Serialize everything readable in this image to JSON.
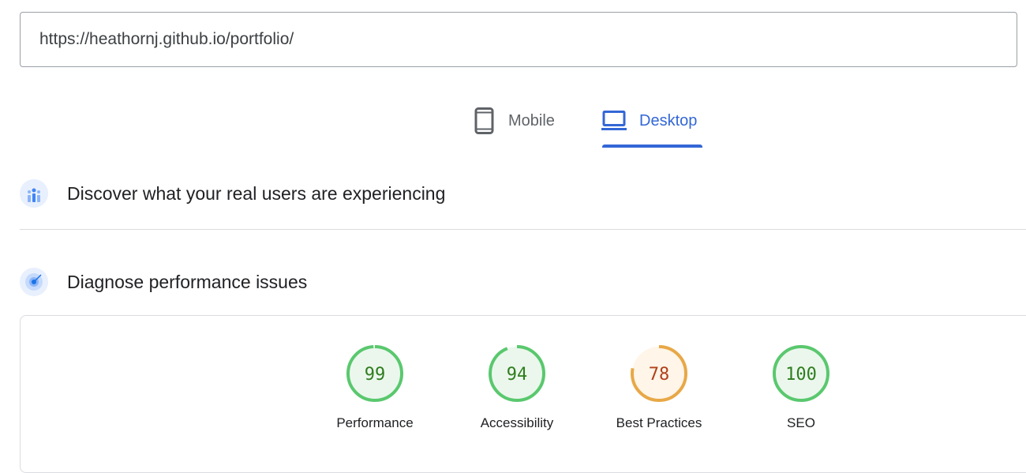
{
  "url_input": {
    "value": "https://heathornj.github.io/portfolio/"
  },
  "tabs": {
    "mobile_label": "Mobile",
    "desktop_label": "Desktop",
    "selected": "Desktop"
  },
  "sections": {
    "field_data_title": "Discover what your real users are experiencing",
    "lab_data_title": "Diagnose performance issues"
  },
  "scores": [
    {
      "label": "Performance",
      "value": 99,
      "rating": "pass"
    },
    {
      "label": "Accessibility",
      "value": 94,
      "rating": "pass"
    },
    {
      "label": "Best Practices",
      "value": 78,
      "rating": "average"
    },
    {
      "label": "SEO",
      "value": 100,
      "rating": "pass"
    }
  ],
  "colors": {
    "accent_blue": "#3367d6",
    "pass_stroke": "#5ac86e",
    "pass_fill": "#ebf7ed",
    "pass_text": "#2f7d1e",
    "average_stroke": "#e8a847",
    "average_fill": "#fff5e8",
    "average_text": "#b0401a"
  }
}
